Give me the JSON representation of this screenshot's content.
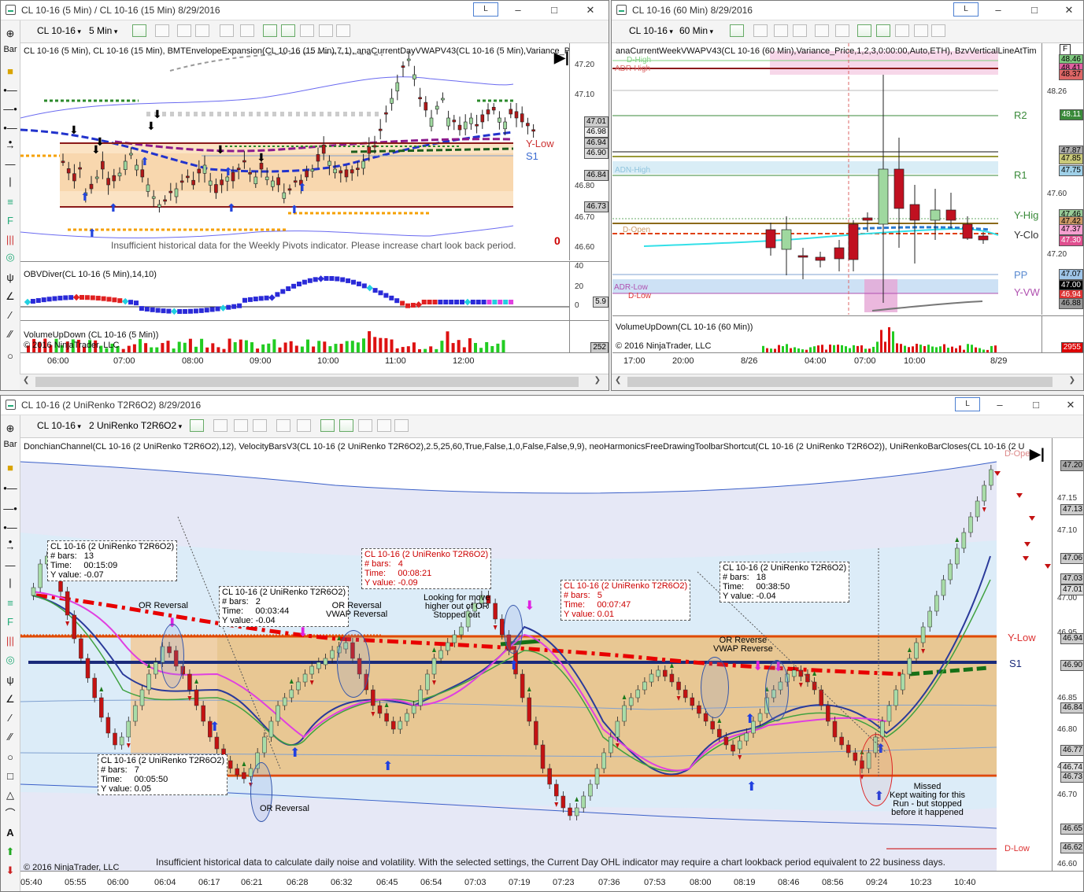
{
  "w1": {
    "title": "CL 10-16 (5 Min) / CL 10-16 (15 Min)  8/29/2016",
    "link": "L",
    "instrument": "CL 10-16",
    "period": "5 Min",
    "indicator_line": "CL 10-16 (5 Min), CL 10-16 (15 Min), BMTEnvelopeExpansion(CL 10-16 (15 Min),7,1), anaCurrentDayVWAPV43(CL 10-16 (5 Min),Variance_P",
    "warning": "Insufficient historical data for the Weekly Pivots indicator. Please increase chart look back period.",
    "warn_num": "0",
    "ylow": "Y-Low",
    "s1": "S1",
    "price_ticks": [
      "47.20",
      "47.10",
      "46.80",
      "46.70",
      "46.60"
    ],
    "price_tags": [
      "47.01",
      "46.98",
      "46.94",
      "46.90",
      "46.84",
      "46.73"
    ],
    "obv_label": "OBVDiver(CL 10-16 (5 Min),14,10)",
    "obv_ticks": [
      "40",
      "20",
      "0"
    ],
    "obv_tag": "5.9",
    "vol_label": "VolumeUpDown (CL 10-16 (5 Min))",
    "vol_tag": "252",
    "copyright": "© 2016 NinjaTrader, LLC",
    "xlabels": [
      "06:00",
      "07:00",
      "08:00",
      "09:00",
      "10:00",
      "11:00",
      "12:00"
    ]
  },
  "w2": {
    "title": "CL 10-16 (60 Min)  8/29/2016",
    "link": "L",
    "instrument": "CL 10-16",
    "period": "60 Min",
    "indicator_line": "anaCurrentWeekVWAPV43(CL 10-16 (60 Min),Variance_Price,1,2,3,0:00:00,Auto,ETH), BzvVerticalLineAtTim",
    "f_btn": "F",
    "left_labels": {
      "dhigh": "D-High",
      "adrhigh": "ADR-High",
      "adnhigh": "ADN-High",
      "dopen": "D-Open",
      "adrlow": "ADR-Low",
      "dlow": "D-Low"
    },
    "right_labels": {
      "r2": "R2",
      "r1": "R1",
      "yhigh": "Y-Hig",
      "yclose": "Y-Clo",
      "pp": "PP",
      "yvw": "Y-VW"
    },
    "price_ticks": [
      "48.26",
      "47.60",
      "47.20"
    ],
    "price_tags": [
      {
        "v": "48.46",
        "c": "#7fc97f"
      },
      {
        "v": "48.41",
        "c": "#e060a0"
      },
      {
        "v": "48.37",
        "c": "#d66"
      },
      {
        "v": "48.11",
        "c": "#3a8a3a"
      },
      {
        "v": "47.87",
        "c": "#aaa"
      },
      {
        "v": "47.85",
        "c": "#c9c97a"
      },
      {
        "v": "47.75",
        "c": "#9fd0e8"
      },
      {
        "v": "47.46",
        "c": "#9c9"
      },
      {
        "v": "47.42",
        "c": "#c96"
      },
      {
        "v": "47.37",
        "c": "#f5a0d0"
      },
      {
        "v": "47.30",
        "c": "#e05090"
      },
      {
        "v": "47.07",
        "c": "#9fc5e8"
      },
      {
        "v": "47.00",
        "c": "#000"
      },
      {
        "v": "46.94",
        "c": "#d33"
      },
      {
        "v": "46.88",
        "c": "#999"
      }
    ],
    "vol_label": "VolumeUpDown(CL 10-16 (60 Min))",
    "vol_tag": "2955",
    "copyright": "© 2016 NinjaTrader, LLC",
    "xlabels": [
      "17:00",
      "20:00",
      "8/26",
      "04:00",
      "07:00",
      "10:00",
      "8/29"
    ]
  },
  "w3": {
    "title": "CL 10-16 (2 UniRenko T2R6O2)  8/29/2016",
    "link": "L",
    "instrument": "CL 10-16",
    "period": "2 UniRenko T2R6O2",
    "indicator_line": "DonchianChannel(CL 10-16 (2 UniRenko T2R6O2),12), VelocityBarsV3(CL 10-16 (2 UniRenko T2R6O2),2.5,25,60,True,False,1,0,False,False,9,9), neoHarmonicsFreeDrawingToolbarShortcut(CL 10-16 (2 UniRenko T2R6O2)), UniRenkoBarCloses(CL 10-16 (2 U",
    "dopen": "D-Ope",
    "ylow": "Y-Low",
    "s1": "S1",
    "dlow": "D-Low",
    "price_ticks": [
      "47.15",
      "47.10",
      "47.00",
      "46.95",
      "46.85",
      "46.80",
      "46.75",
      "46.70",
      "46.60"
    ],
    "price_tags": [
      "47.20",
      "47.13",
      "47.06",
      "47.03",
      "47.01",
      "46.94",
      "46.90",
      "46.84",
      "46.77",
      "46.74",
      "46.73",
      "46.65",
      "46.62"
    ],
    "warning": "Insufficient historical data to calculate daily noise and volatility. With the selected settings, the Current Day OHL indicator may require a chart lookback period equivalent to 22 business days.",
    "copyright": "© 2016 NinjaTrader, LLC",
    "xlabels": [
      "05:40",
      "05:55",
      "06:00",
      "06:04",
      "06:17",
      "06:21",
      "06:28",
      "06:32",
      "06:45",
      "06:54",
      "07:03",
      "07:19",
      "07:23",
      "07:36",
      "07:53",
      "08:00",
      "08:19",
      "08:46",
      "08:56",
      "09:24",
      "10:23",
      "10:40"
    ],
    "boxes": [
      {
        "lines": "CL 10-16 (2 UniRenko T2R6O2)\n# bars:   13\nTime:     00:15:09\nY value: -0.07",
        "red": false
      },
      {
        "lines": "CL 10-16 (2 UniRenko T2R6O2)\n# bars:   2\nTime:     00:03:44\nY value: -0.04",
        "red": false
      },
      {
        "lines": "CL 10-16 (2 UniRenko T2R6O2)\n# bars:   4\nTime:     00:08:21\nY value: -0.09",
        "red": true
      },
      {
        "lines": "CL 10-16 (2 UniRenko T2R6O2)\n# bars:   5\nTime:     00:07:47\nY value: 0.01",
        "red": true
      },
      {
        "lines": "CL 10-16 (2 UniRenko T2R6O2)\n# bars:   18\nTime:     00:38:50\nY value: -0.04",
        "red": false
      },
      {
        "lines": "CL 10-16 (2 UniRenko T2R6O2)\n# bars:   7\nTime:     00:05:50\nY value: 0.05",
        "red": false
      }
    ],
    "notes": [
      "OR Reversal",
      "OR Reversal\nVWAP Reversal",
      "Looking for move\nhigher out of OR\nStopped out",
      "OR Reverse\nVWAP Reverse",
      "OR Reversal",
      "Missed\nKept waiting for this\nRun - but stopped\nbefore it happened"
    ]
  },
  "side_labels": {
    "bar": "Bar"
  }
}
